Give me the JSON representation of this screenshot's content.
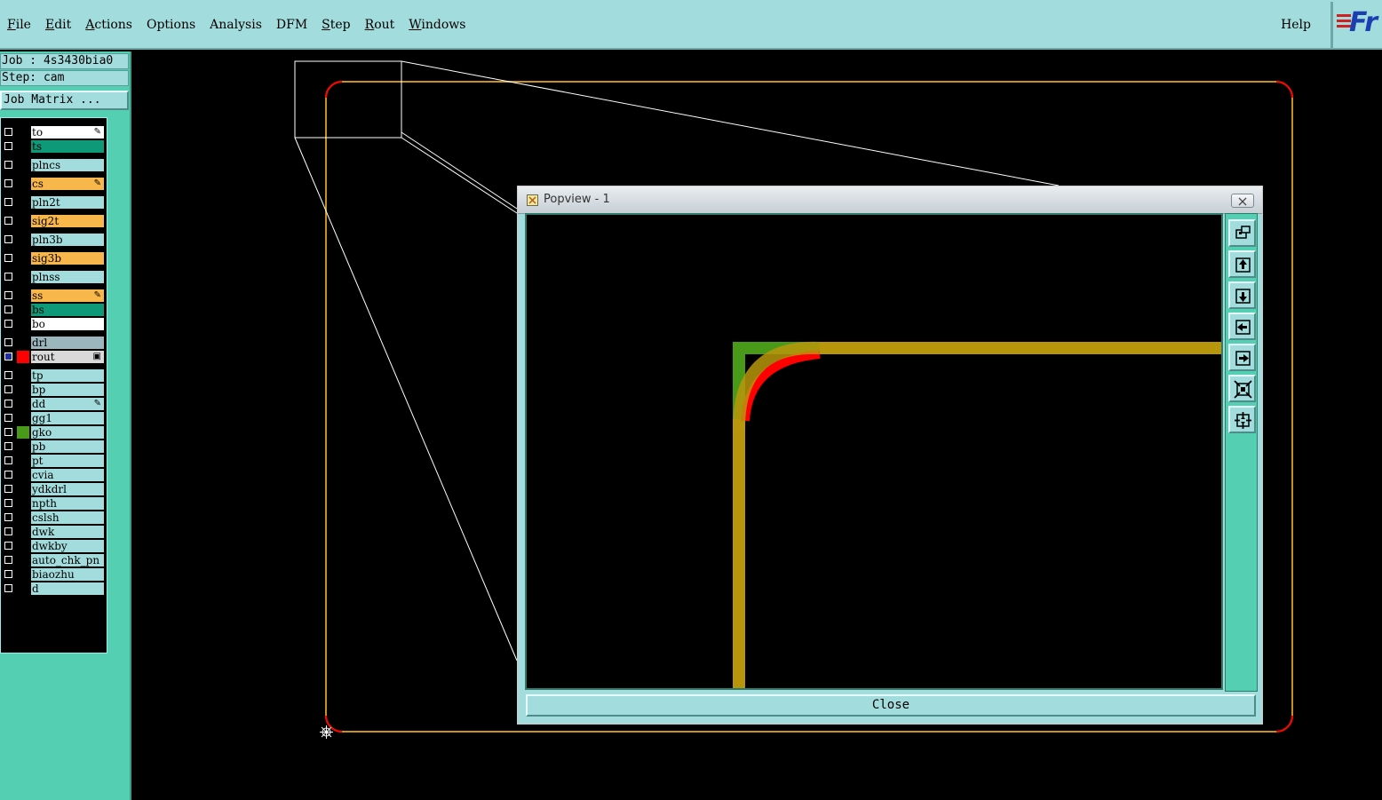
{
  "menubar": {
    "items": [
      {
        "label": "File"
      },
      {
        "label": "Edit"
      },
      {
        "label": "Actions"
      },
      {
        "label": "Options"
      },
      {
        "label": "Analysis"
      },
      {
        "label": "DFM"
      },
      {
        "label": "Step"
      },
      {
        "label": "Rout"
      },
      {
        "label": "Windows"
      }
    ],
    "help": "Help",
    "logo": "Fr"
  },
  "left_panel": {
    "job": "Job : 4s3430bia0",
    "step": "Step: cam",
    "job_matrix_button": "Job Matrix ...",
    "layers": [
      {
        "name": "to",
        "color": "#ffffff",
        "mark": "✎"
      },
      {
        "name": "ts",
        "color": "#0e9a78",
        "mark": ""
      },
      {
        "name": "plncs",
        "color": "#a3dcdc",
        "mark": ""
      },
      {
        "name": "cs",
        "color": "#f8b74a",
        "mark": "✎"
      },
      {
        "name": "pln2t",
        "color": "#a3dcdc",
        "mark": ""
      },
      {
        "name": "sig2t",
        "color": "#f8b74a",
        "mark": ""
      },
      {
        "name": "pln3b",
        "color": "#a3dcdc",
        "mark": ""
      },
      {
        "name": "sig3b",
        "color": "#f8b74a",
        "mark": ""
      },
      {
        "name": "plnss",
        "color": "#a3dcdc",
        "mark": ""
      },
      {
        "name": "ss",
        "color": "#f8b74a",
        "mark": "✎"
      },
      {
        "name": "bs",
        "color": "#0e9a78",
        "mark": ""
      },
      {
        "name": "bo",
        "color": "#ffffff",
        "mark": ""
      },
      {
        "name": "drl",
        "color": "#9bb7bd",
        "mark": ""
      },
      {
        "name": "rout",
        "color": "#d9d9d9",
        "mark": "▣",
        "selected": true,
        "swatch": "#ff0000"
      },
      {
        "name": "tp",
        "color": "#a3dcdc",
        "mark": ""
      },
      {
        "name": "bp",
        "color": "#a3dcdc",
        "mark": ""
      },
      {
        "name": "dd",
        "color": "#a3dcdc",
        "mark": "✎"
      },
      {
        "name": "gg1",
        "color": "#a3dcdc",
        "mark": ""
      },
      {
        "name": "gko",
        "color": "#a3dcdc",
        "mark": "",
        "swatch": "#4a9a1a"
      },
      {
        "name": "pb",
        "color": "#a3dcdc",
        "mark": ""
      },
      {
        "name": "pt",
        "color": "#a3dcdc",
        "mark": ""
      },
      {
        "name": "cvia",
        "color": "#a3dcdc",
        "mark": ""
      },
      {
        "name": "ydkdrl",
        "color": "#a3dcdc",
        "mark": ""
      },
      {
        "name": "npth",
        "color": "#a3dcdc",
        "mark": ""
      },
      {
        "name": "cslsh",
        "color": "#a3dcdc",
        "mark": ""
      },
      {
        "name": "dwk",
        "color": "#a3dcdc",
        "mark": ""
      },
      {
        "name": "dwkby",
        "color": "#a3dcdc",
        "mark": ""
      },
      {
        "name": "auto_chk_pn",
        "color": "#a3dcdc",
        "mark": ""
      },
      {
        "name": "biaozhu",
        "color": "#a3dcdc",
        "mark": ""
      },
      {
        "name": "d",
        "color": "#a3dcdc",
        "mark": ""
      }
    ]
  },
  "popview": {
    "title": "Popview - 1",
    "close_button": "Close",
    "tools": [
      "zoom-window-icon",
      "pan-up-icon",
      "pan-down-icon",
      "pan-left-icon",
      "pan-right-icon",
      "zoom-out-icon",
      "zoom-in-icon"
    ]
  },
  "colors": {
    "outline": "#c8911e",
    "rout_corner": "#ff0000",
    "gko": "#4a9a1a",
    "trace": "#b8960c"
  }
}
